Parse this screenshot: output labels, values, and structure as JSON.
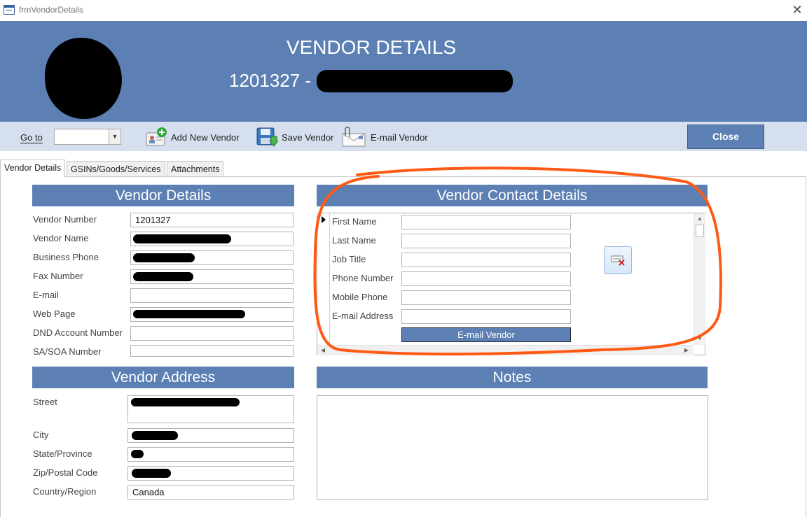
{
  "window": {
    "title": "frmVendorDetails",
    "close_glyph": "✕"
  },
  "header": {
    "title": "VENDOR DETAILS",
    "vendor_id_prefix": "1201327 -"
  },
  "toolbar": {
    "goto_label": "Go to",
    "goto_value": "",
    "add_vendor": "Add New Vendor",
    "save_vendor": "Save Vendor",
    "email_vendor": "E-mail Vendor",
    "close": "Close"
  },
  "tabs": [
    {
      "label": "Vendor Details",
      "active": true
    },
    {
      "label": "GSINs/Goods/Services",
      "active": false
    },
    {
      "label": "Attachments",
      "active": false
    }
  ],
  "vendor_details": {
    "heading": "Vendor Details",
    "fields": [
      {
        "label": "Vendor Number",
        "value": "1201327"
      },
      {
        "label": "Vendor Name",
        "value": ""
      },
      {
        "label": "Business Phone",
        "value": ""
      },
      {
        "label": "Fax Number",
        "value": ""
      },
      {
        "label": "E-mail",
        "value": ""
      },
      {
        "label": "Web Page",
        "value": ""
      },
      {
        "label": "DND Account Number",
        "value": ""
      },
      {
        "label": "SA/SOA Number",
        "value": ""
      }
    ]
  },
  "vendor_contact": {
    "heading": "Vendor Contact Details",
    "fields": [
      {
        "label": "First Name",
        "value": ""
      },
      {
        "label": "Last Name",
        "value": ""
      },
      {
        "label": "Job Title",
        "value": ""
      },
      {
        "label": "Phone Number",
        "value": ""
      },
      {
        "label": "Mobile Phone",
        "value": ""
      },
      {
        "label": "E-mail Address",
        "value": ""
      }
    ],
    "email_button": "E-mail Vendor"
  },
  "vendor_address": {
    "heading": "Vendor Address",
    "street_label": "Street",
    "city_label": "City",
    "state_label": "State/Province",
    "zip_label": "Zip/Postal Code",
    "country_label": "Country/Region",
    "country_value": "Canada"
  },
  "notes": {
    "heading": "Notes",
    "value": ""
  },
  "colors": {
    "accent": "#5c7fb4",
    "toolbar_bg": "#d6dfee",
    "annotation": "#ff5a14"
  }
}
